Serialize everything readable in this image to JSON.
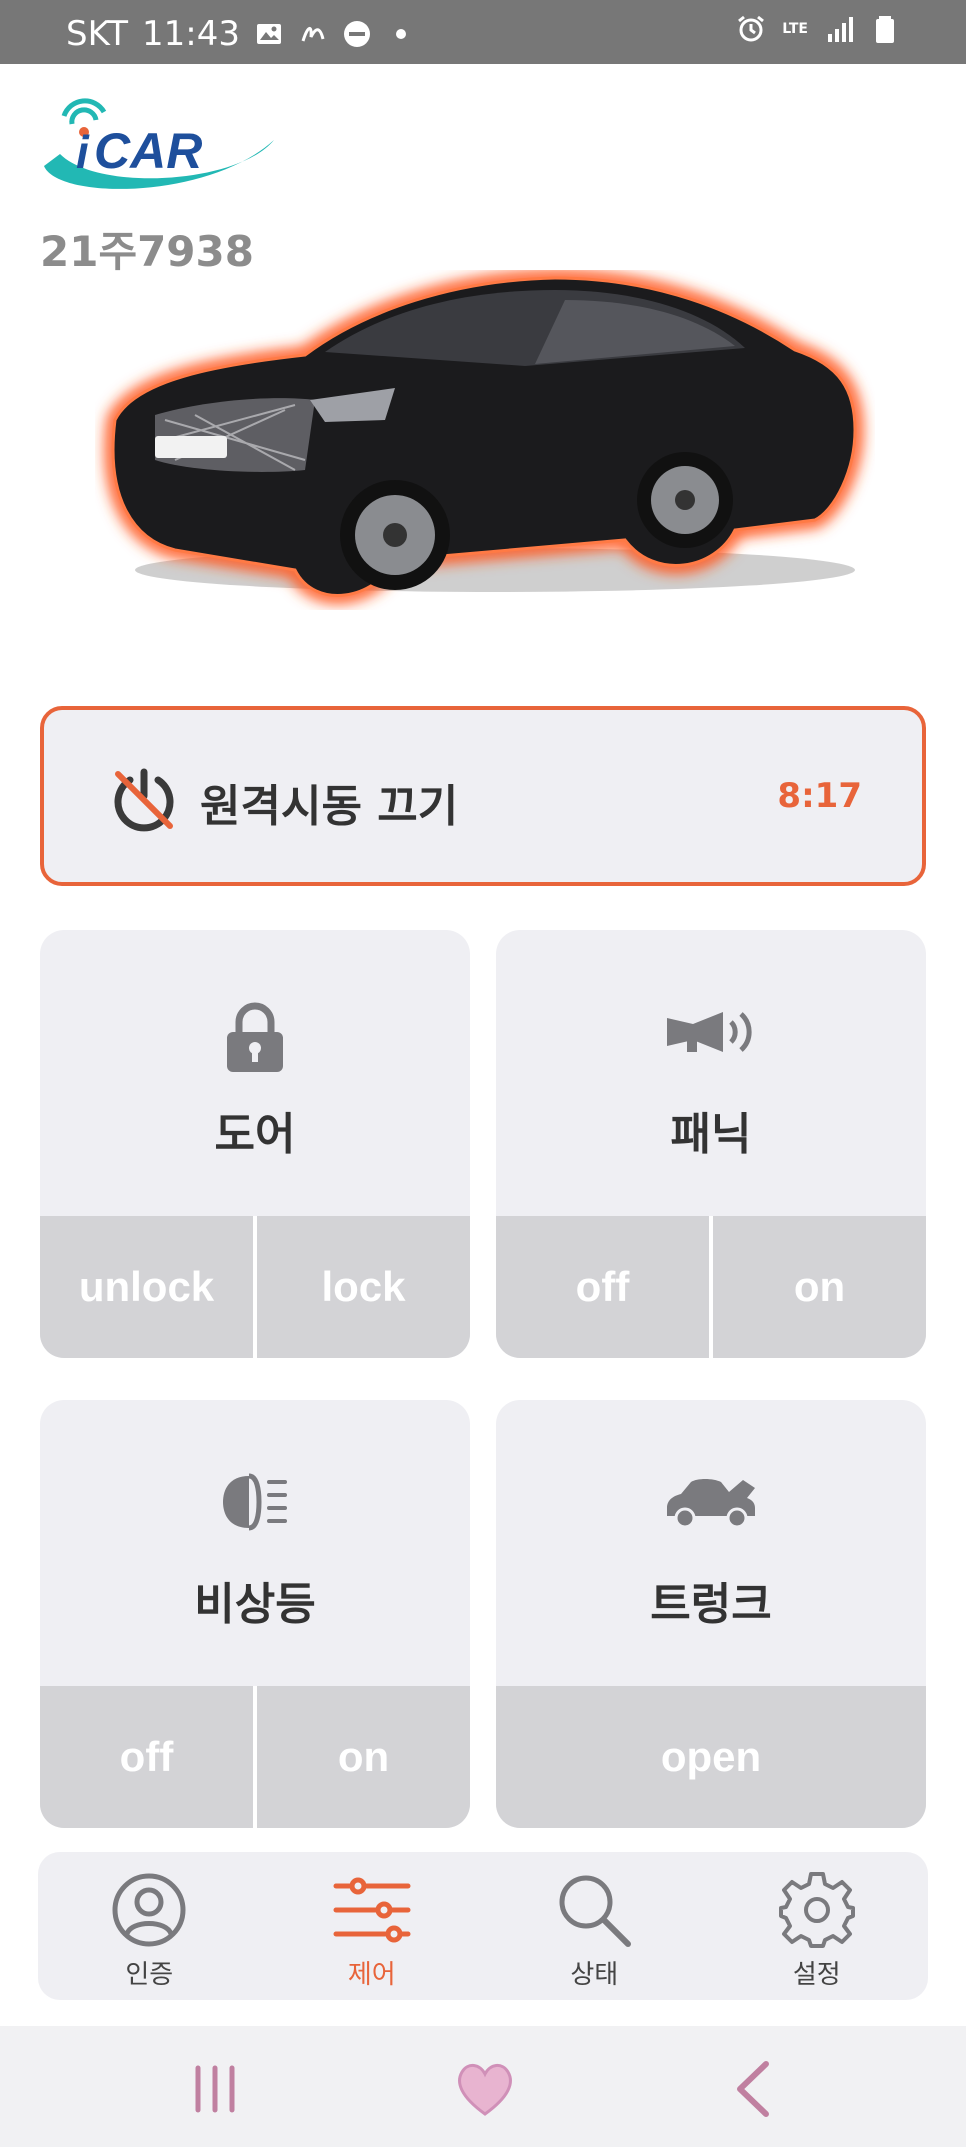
{
  "status_bar": {
    "carrier": "SKT",
    "time": "11:43",
    "network": "LTE"
  },
  "header": {
    "logo_text": "iCAR",
    "plate_number": "21주7938"
  },
  "remote_start": {
    "label": "원격시동 끄기",
    "timer": "8:17"
  },
  "controls": {
    "door": {
      "title": "도어",
      "actions": [
        "unlock",
        "lock"
      ]
    },
    "panic": {
      "title": "패닉",
      "actions": [
        "off",
        "on"
      ]
    },
    "hazard": {
      "title": "비상등",
      "actions": [
        "off",
        "on"
      ]
    },
    "trunk": {
      "title": "트렁크",
      "actions": [
        "open"
      ]
    }
  },
  "bottom_nav": {
    "items": [
      {
        "label": "인증",
        "icon": "user-icon",
        "active": false
      },
      {
        "label": "제어",
        "icon": "sliders-icon",
        "active": true
      },
      {
        "label": "상태",
        "icon": "search-icon",
        "active": false
      },
      {
        "label": "설정",
        "icon": "gear-icon",
        "active": false
      }
    ]
  },
  "colors": {
    "accent": "#e8643a",
    "tile_bg": "#efeff3",
    "action_bg": "#d3d3d6",
    "status_bar": "#777777"
  }
}
